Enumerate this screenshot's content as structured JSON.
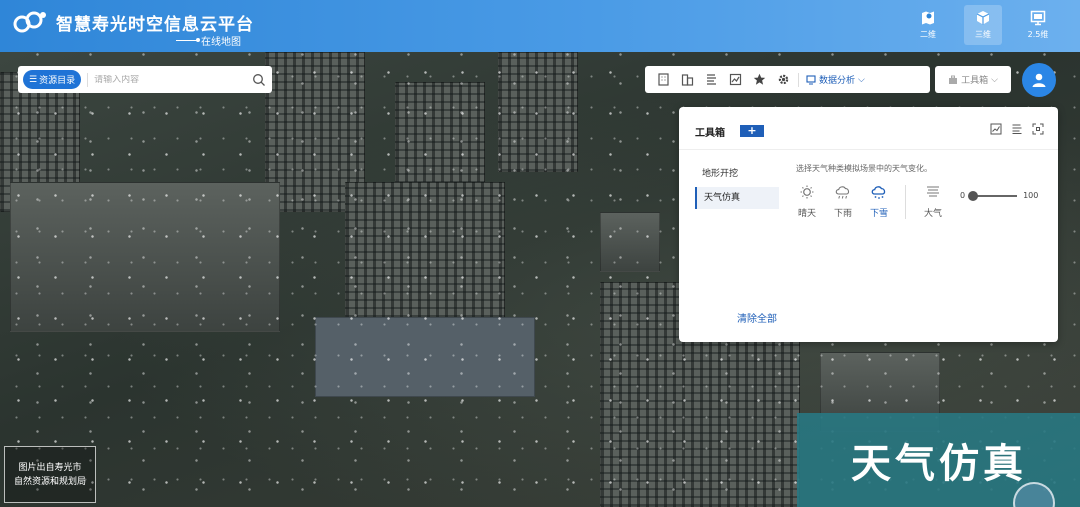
{
  "header": {
    "title": "智慧寿光时空信息云平台",
    "subtitle": "在线地图",
    "views": [
      {
        "label": "二维",
        "icon": "map-pin-icon"
      },
      {
        "label": "三维",
        "icon": "cube-icon",
        "active": true
      },
      {
        "label": "2.5维",
        "icon": "monitor-icon"
      }
    ]
  },
  "search": {
    "resource_label": "资源目录",
    "placeholder": "请输入内容"
  },
  "toolbar": {
    "icons": [
      "building-icon",
      "city-icon",
      "layers-list-icon",
      "chart-icon",
      "star-icon",
      "gear-icon"
    ],
    "data_analysis_label": "数据分析",
    "toolbox_label": "工具箱"
  },
  "panel": {
    "title": "工具箱",
    "add_label": "+",
    "side_items": [
      "地形开挖",
      "天气仿真"
    ],
    "active_item": "天气仿真",
    "description": "选择天气种类模拟场景中的天气变化。",
    "weather": [
      {
        "label": "晴天",
        "icon": "sun-icon"
      },
      {
        "label": "下雨",
        "icon": "rain-icon"
      },
      {
        "label": "下雪",
        "icon": "snow-icon",
        "active": true
      }
    ],
    "atmosphere": {
      "label": "大气",
      "icon": "atmosphere-icon"
    },
    "slider": {
      "min": "0",
      "max": "100",
      "value": 0
    },
    "clear_label": "清除全部"
  },
  "overlay": {
    "credit_line1": "图片出自寿光市",
    "credit_line2": "自然资源和规划局",
    "banner": "天气仿真"
  },
  "colors": {
    "header_start": "#2f86d8",
    "accent": "#1f5fb8",
    "banner_bg": "#28787f"
  }
}
